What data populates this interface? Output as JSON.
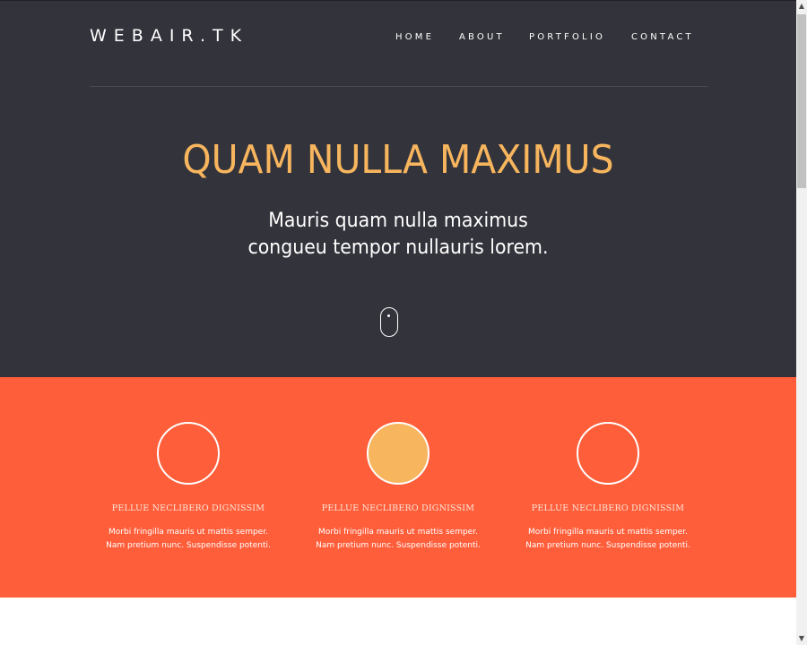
{
  "header": {
    "logo": "WEBAIR.TK",
    "nav": [
      {
        "label": "HOME"
      },
      {
        "label": "ABOUT"
      },
      {
        "label": "PORTFOLIO"
      },
      {
        "label": "CONTACT"
      }
    ]
  },
  "hero": {
    "title": "QUAM NULLA MAXIMUS",
    "subtitle_line1": "Mauris quam nulla maximus",
    "subtitle_line2": "congueu tempor nullauris lorem.",
    "scroll_icon": "mouse-icon"
  },
  "features": [
    {
      "title": "PELLUE NECLIBERO DIGNISSIM",
      "line1": "Morbi fringilla mauris ut mattis semper.",
      "line2": "Nam pretium nunc. Suspendisse potenti.",
      "circle": "outline"
    },
    {
      "title": "PELLUE NECLIBERO DIGNISSIM",
      "line1": "Morbi fringilla mauris ut mattis semper.",
      "line2": "Nam pretium nunc. Suspendisse potenti.",
      "circle": "filled"
    },
    {
      "title": "PELLUE NECLIBERO DIGNISSIM",
      "line1": "Morbi fringilla mauris ut mattis semper.",
      "line2": "Nam pretium nunc. Suspendisse potenti.",
      "circle": "outline"
    }
  ],
  "colors": {
    "hero_bg": "#33333b",
    "accent": "#f7b55e",
    "features_bg": "#ff5e3a"
  }
}
